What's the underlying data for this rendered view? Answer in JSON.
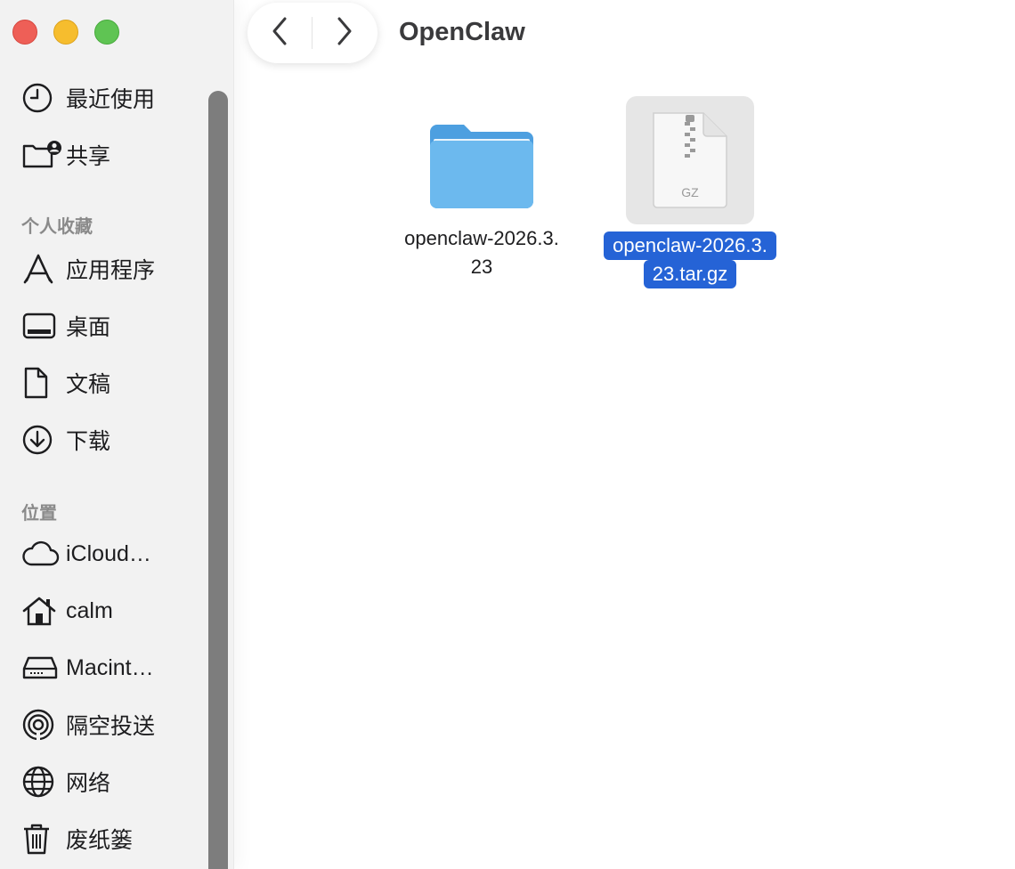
{
  "window": {
    "title": "OpenClaw"
  },
  "sidebar": {
    "items_top": [
      {
        "label": "最近使用",
        "icon": "clock-icon"
      },
      {
        "label": "共享",
        "icon": "shared-folder-icon"
      }
    ],
    "section_personal": "个人收藏",
    "items_personal": [
      {
        "label": "应用程序",
        "icon": "applications-icon"
      },
      {
        "label": "桌面",
        "icon": "desktop-icon"
      },
      {
        "label": "文稿",
        "icon": "document-icon"
      },
      {
        "label": "下载",
        "icon": "download-icon"
      }
    ],
    "section_locations": "位置",
    "items_locations": [
      {
        "label": "iCloud…",
        "icon": "cloud-icon"
      },
      {
        "label": "calm",
        "icon": "home-icon"
      },
      {
        "label": "Macint…",
        "icon": "hard-drive-icon"
      },
      {
        "label": "隔空投送",
        "icon": "airdrop-icon"
      },
      {
        "label": "网络",
        "icon": "globe-icon"
      },
      {
        "label": "废纸篓",
        "icon": "trash-icon"
      }
    ]
  },
  "files": [
    {
      "name_line1": "openclaw-2026.3.",
      "name_line2": "23",
      "icon": "folder-icon",
      "selected": false
    },
    {
      "name_line1": "openclaw-2026.3.",
      "name_line2": "23.tar.gz",
      "icon": "gz-archive-icon",
      "badge": "GZ",
      "selected": true
    }
  ],
  "colors": {
    "selection": "#2563d6",
    "folder": "#5eb0ea",
    "close": "#ee5f57",
    "minimize": "#f6bd2e",
    "zoom": "#5fc453"
  }
}
